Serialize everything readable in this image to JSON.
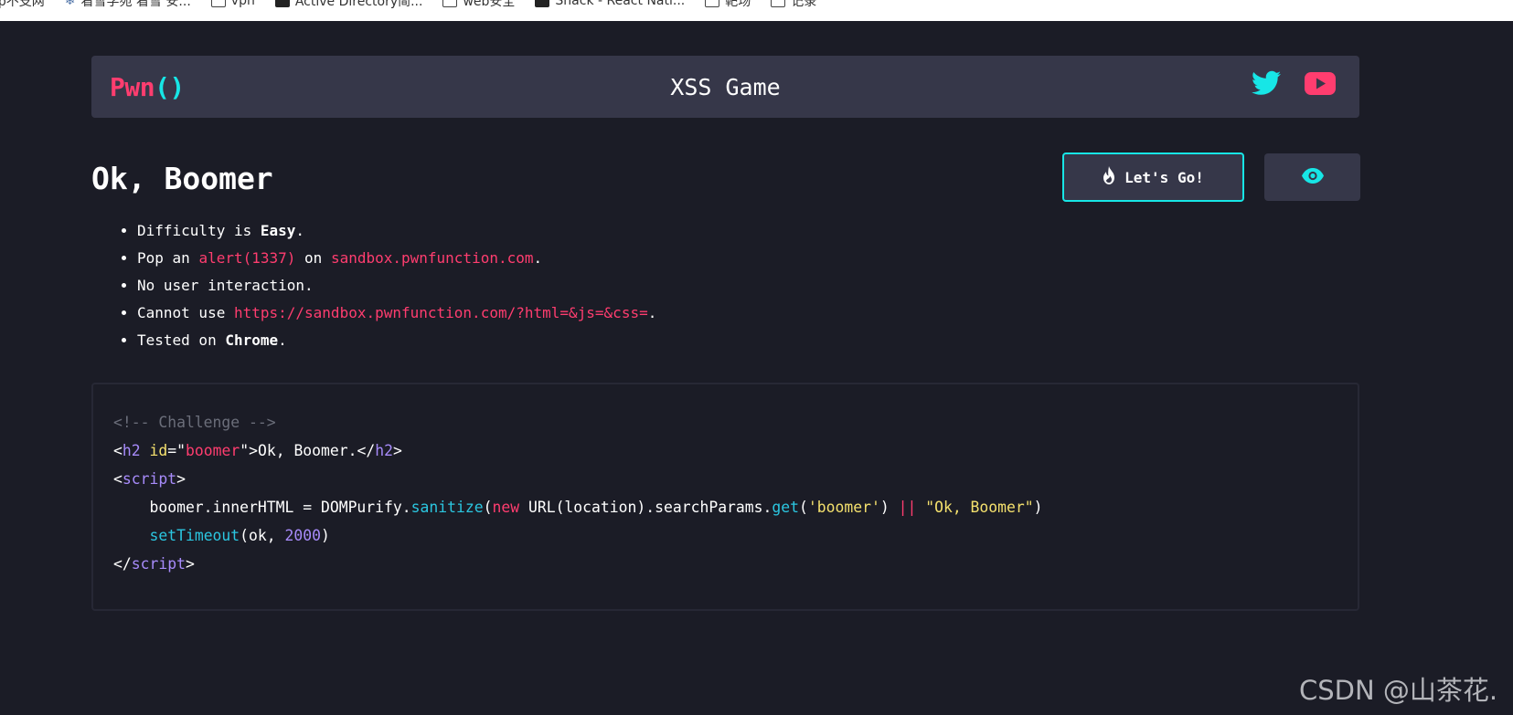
{
  "bookmarks": [
    {
      "label": "ip不支网",
      "icon": "none"
    },
    {
      "label": "看雪学苑 看雪 安...",
      "icon": "snowflake-icon"
    },
    {
      "label": "vpn",
      "icon": "folder-icon"
    },
    {
      "label": "Active Directory简...",
      "icon": "terminal-icon"
    },
    {
      "label": "web安全",
      "icon": "folder-icon"
    },
    {
      "label": "Snack - React Nati...",
      "icon": "cube-icon"
    },
    {
      "label": "靶场",
      "icon": "folder-icon"
    },
    {
      "label": "记录",
      "icon": "folder-icon"
    }
  ],
  "header": {
    "logo_main": "Pwn",
    "logo_paren": "()",
    "title": "XSS Game",
    "icons": [
      "twitter-icon",
      "youtube-icon"
    ]
  },
  "challenge": {
    "title": "Ok, Boomer",
    "rules": {
      "r1_pre": "Difficulty is ",
      "r1_bold": "Easy",
      "r1_post": ".",
      "r2_pre": "Pop an ",
      "r2_code1": "alert(1337)",
      "r2_mid": " on ",
      "r2_code2": "sandbox.pwnfunction.com",
      "r2_post": ".",
      "r3": "No user interaction.",
      "r4_pre": "Cannot use ",
      "r4_code": "https://sandbox.pwnfunction.com/?html=&js=&css=",
      "r4_post": ".",
      "r5_pre": "Tested on ",
      "r5_bold": "Chrome",
      "r5_post": "."
    }
  },
  "buttons": {
    "go_label": "Let's Go!",
    "go_icon": "flame-icon",
    "view_icon": "eye-icon"
  },
  "code": {
    "comment": "<!-- Challenge -->",
    "l2_open": "<",
    "l2_tag": "h2",
    "l2_attr": "id",
    "l2_eq": "=\"",
    "l2_val": "boomer",
    "l2_gt": "\">",
    "l2_text": "Ok, Boomer.",
    "l2_close_open": "</",
    "l2_close_tag": "h2",
    "l2_close_gt": ">",
    "l3_open": "<",
    "l3_tag": "script",
    "l3_gt": ">",
    "l4_a": "    boomer.innerHTML = DOMPurify.",
    "l4_fn1": "sanitize",
    "l4_b": "(",
    "l4_kw": "new",
    "l4_c": " URL(location).searchParams.",
    "l4_fn2": "get",
    "l4_d": "(",
    "l4_s1": "'boomer'",
    "l4_e": ") ",
    "l4_op": "||",
    "l4_f": " ",
    "l4_s2": "\"Ok, Boomer\"",
    "l4_g": ")",
    "l5_indent": "    ",
    "l5_fn": "setTimeout",
    "l5_a": "(ok, ",
    "l5_num": "2000",
    "l5_b": ")",
    "l6_open": "</",
    "l6_tag": "script",
    "l6_gt": ">"
  },
  "watermark": "CSDN @山茶花.",
  "colors": {
    "background": "#1b1c26",
    "panel": "#363749",
    "accent_pink": "#ff3d6f",
    "accent_cyan": "#17e6e6"
  }
}
